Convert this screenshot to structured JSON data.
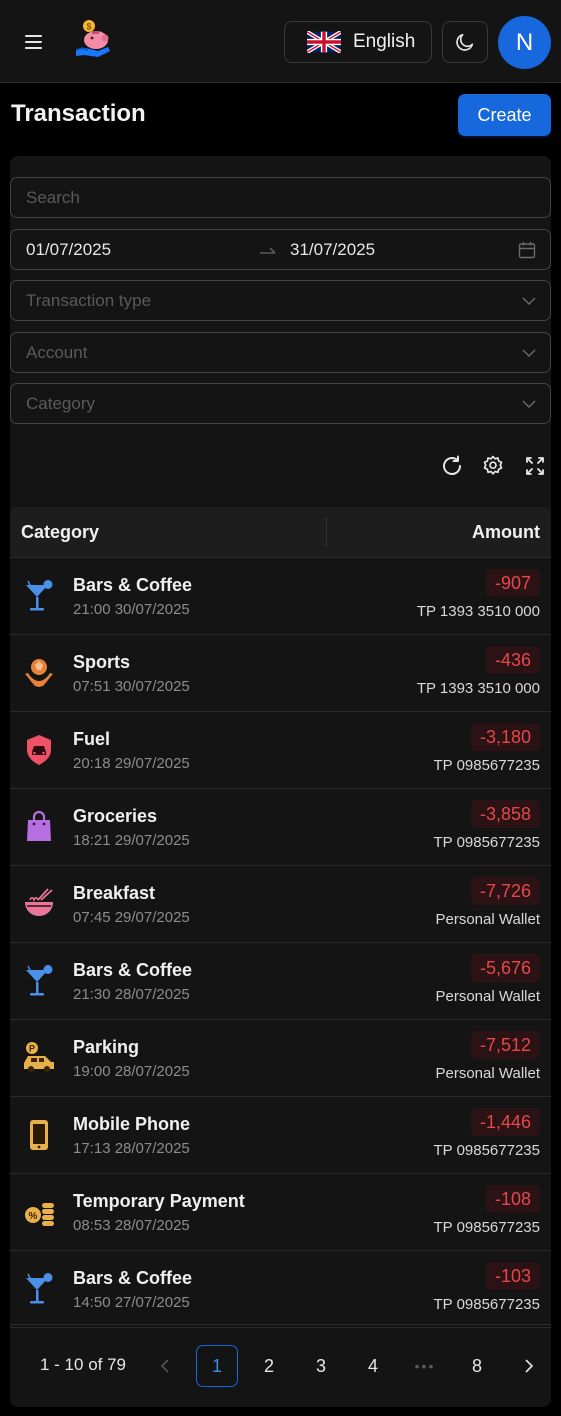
{
  "header": {
    "language_label": "English",
    "avatar_initial": "N"
  },
  "page": {
    "title": "Transaction",
    "create_label": "Create"
  },
  "filters": {
    "search_placeholder": "Search",
    "date_from": "01/07/2025",
    "date_to": "31/07/2025",
    "transaction_type_placeholder": "Transaction type",
    "account_placeholder": "Account",
    "category_placeholder": "Category"
  },
  "table": {
    "columns": {
      "category": "Category",
      "amount": "Amount"
    },
    "rows": [
      {
        "icon": "cocktail-icon",
        "name": "Bars & Coffee",
        "time": "21:00 30/07/2025",
        "amount": "-907",
        "account": "TP 1393 3510 000"
      },
      {
        "icon": "sports-ball-icon",
        "name": "Sports",
        "time": "07:51 30/07/2025",
        "amount": "-436",
        "account": "TP 1393 3510 000"
      },
      {
        "icon": "fuel-car-icon",
        "name": "Fuel",
        "time": "20:18 29/07/2025",
        "amount": "-3,180",
        "account": "TP 0985677235"
      },
      {
        "icon": "shopping-bag-icon",
        "name": "Groceries",
        "time": "18:21 29/07/2025",
        "amount": "-3,858",
        "account": "TP 0985677235"
      },
      {
        "icon": "noodle-bowl-icon",
        "name": "Breakfast",
        "time": "07:45 29/07/2025",
        "amount": "-7,726",
        "account": "Personal Wallet"
      },
      {
        "icon": "cocktail-icon",
        "name": "Bars & Coffee",
        "time": "21:30 28/07/2025",
        "amount": "-5,676",
        "account": "Personal Wallet"
      },
      {
        "icon": "parking-car-icon",
        "name": "Parking",
        "time": "19:00 28/07/2025",
        "amount": "-7,512",
        "account": "Personal Wallet"
      },
      {
        "icon": "mobile-phone-icon",
        "name": "Mobile Phone",
        "time": "17:13 28/07/2025",
        "amount": "-1,446",
        "account": "TP 0985677235"
      },
      {
        "icon": "coins-icon",
        "name": "Temporary Payment",
        "time": "08:53 28/07/2025",
        "amount": "-108",
        "account": "TP 0985677235"
      },
      {
        "icon": "cocktail-icon",
        "name": "Bars & Coffee",
        "time": "14:50 27/07/2025",
        "amount": "-103",
        "account": "TP 0985677235"
      }
    ]
  },
  "pagination": {
    "total_label": "1 - 10 of 79",
    "pages": [
      "1",
      "2",
      "3",
      "4",
      "8"
    ],
    "current": "1",
    "ellipsis": "•••"
  },
  "colors": {
    "accent": "#1668dc",
    "negative": "#e84749",
    "background": "#000000",
    "card": "#141414"
  }
}
